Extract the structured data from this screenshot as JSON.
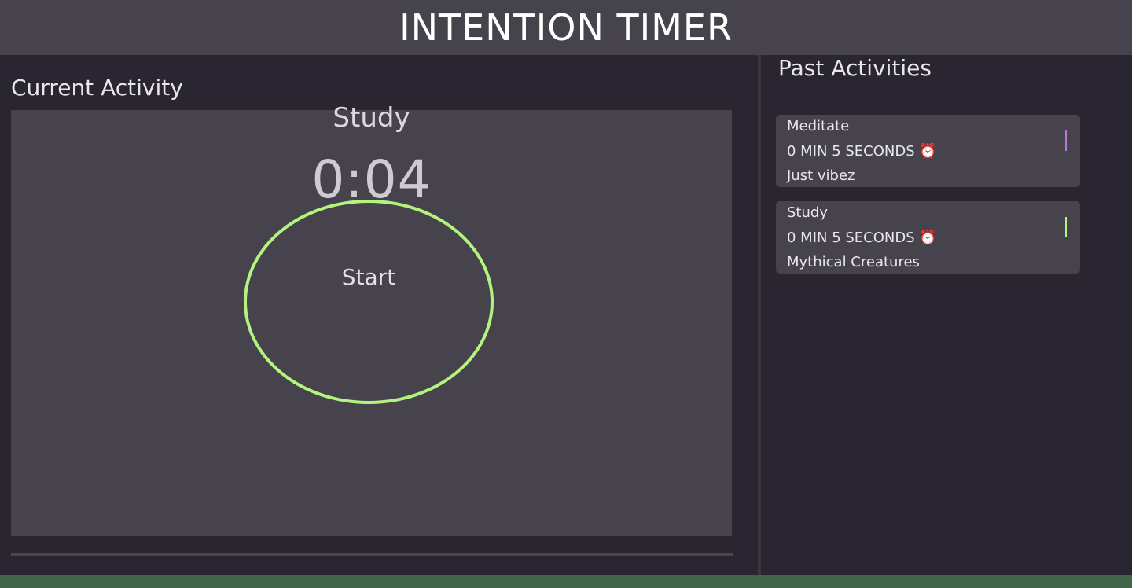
{
  "header": {
    "title": "INTENTION TIMER"
  },
  "current": {
    "section_title": "Current Activity",
    "activity_name": "Study",
    "time": "0:04",
    "start_label": "Start",
    "ring_color": "#b3f47f"
  },
  "past": {
    "section_title": "Past Activities",
    "items": [
      {
        "name": "Meditate",
        "duration": "0 MIN 5 SECONDS ⏰",
        "note": "Just vibez",
        "color": "#b27ad6"
      },
      {
        "name": "Study",
        "duration": "0 MIN 5 SECONDS ⏰",
        "note": "Mythical Creatures",
        "color": "#b3f47f"
      }
    ]
  }
}
